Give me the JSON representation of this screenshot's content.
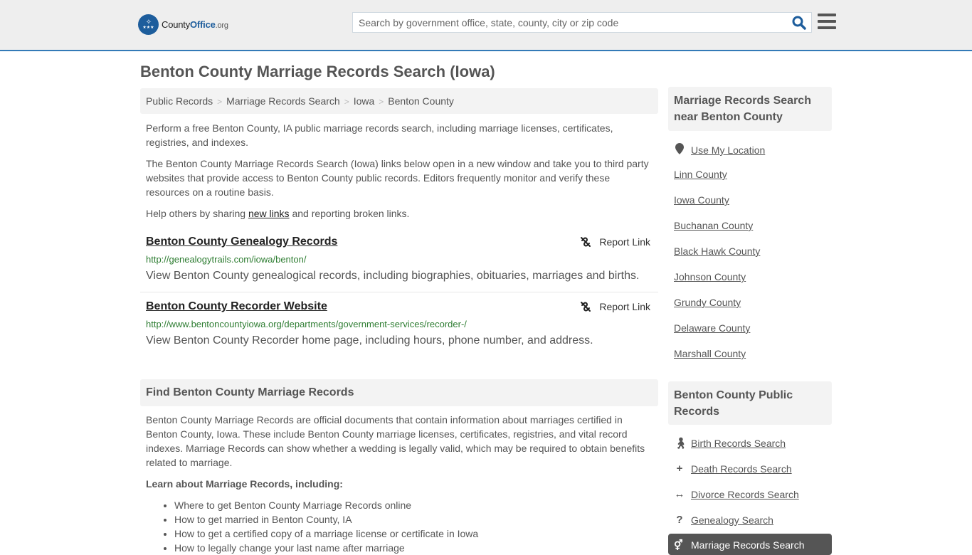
{
  "header": {
    "logo": {
      "name": "County",
      "office": "Office",
      "tld": ".org"
    },
    "search_placeholder": "Search by government office, state, county, city or zip code",
    "search_value": ""
  },
  "page": {
    "title": "Benton County Marriage Records Search (Iowa)"
  },
  "breadcrumb": [
    {
      "label": "Public Records"
    },
    {
      "label": "Marriage Records Search"
    },
    {
      "label": "Iowa"
    },
    {
      "label": "Benton County"
    }
  ],
  "intro": {
    "p1": "Perform a free Benton County, IA public marriage records search, including marriage licenses, certificates, registries, and indexes.",
    "p2": "The Benton County Marriage Records Search (Iowa) links below open in a new window and take you to third party websites that provide access to Benton County public records. Editors frequently monitor and verify these resources on a routine basis.",
    "p3_before": "Help others by sharing ",
    "p3_link": "new links",
    "p3_after": " and reporting broken links."
  },
  "results": [
    {
      "title": "Benton County Genealogy Records",
      "url": "http://genealogytrails.com/iowa/benton/",
      "description": "View Benton County genealogical records, including biographies, obituaries, marriages and births.",
      "report_label": "Report Link"
    },
    {
      "title": "Benton County Recorder Website",
      "url": "http://www.bentoncountyiowa.org/departments/government-services/recorder-/",
      "description": "View Benton County Recorder home page, including hours, phone number, and address.",
      "report_label": "Report Link"
    }
  ],
  "find_section": {
    "heading": "Find Benton County Marriage Records",
    "body": "Benton County Marriage Records are official documents that contain information about marriages certified in Benton County, Iowa. These include Benton County marriage licenses, certificates, registries, and vital record indexes. Marriage Records can show whether a wedding is legally valid, which may be required to obtain benefits related to marriage.",
    "learn_heading": "Learn about Marriage Records, including:",
    "learn_items": [
      "Where to get Benton County Marriage Records online",
      "How to get married in Benton County, IA",
      "How to get a certified copy of a marriage license or certificate in Iowa",
      "How to legally change your last name after marriage"
    ]
  },
  "sidebar": {
    "nearby": {
      "heading": "Marriage Records Search near Benton County",
      "use_location": "Use My Location",
      "counties": [
        "Linn County",
        "Iowa County",
        "Buchanan County",
        "Black Hawk County",
        "Johnson County",
        "Grundy County",
        "Delaware County",
        "Marshall County"
      ]
    },
    "public_records": {
      "heading": "Benton County Public Records",
      "items": [
        {
          "label": "Birth Records Search",
          "icon": "child-icon"
        },
        {
          "label": "Death Records Search",
          "icon": "plus-icon"
        },
        {
          "label": "Divorce Records Search",
          "icon": "arrows-horizontal-icon"
        },
        {
          "label": "Genealogy Search",
          "icon": "question-icon"
        },
        {
          "label": "Marriage Records Search",
          "icon": "marriage-icon",
          "active": true
        }
      ]
    }
  },
  "colors": {
    "header_bg": "#eeeeee",
    "header_border": "#337ab7",
    "brand_blue": "#1d5d9c",
    "url_green": "#2e7d32",
    "text": "#555555",
    "panel_bg": "#f3f3f3",
    "active_bg": "#555555"
  }
}
